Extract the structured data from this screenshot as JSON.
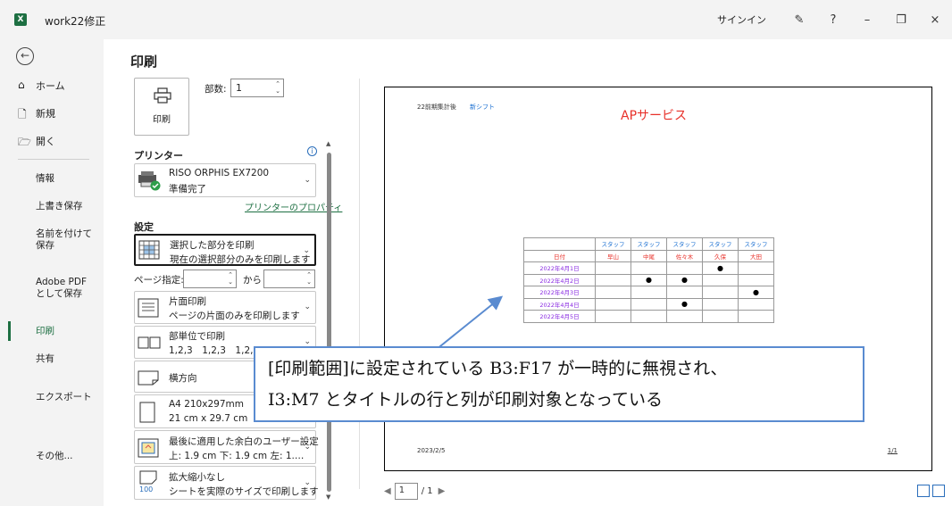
{
  "window": {
    "app_icon": "excel-icon",
    "title": "work22修正",
    "signin": "サインイン",
    "controls": [
      "pen-icon",
      "?",
      "–",
      "restore-icon",
      "×"
    ]
  },
  "nav": {
    "back": "⊖",
    "home": "ホーム",
    "new": "新規",
    "open": "開く",
    "info": "情報",
    "save": "上書き保存",
    "saveas": "名前を付けて保存",
    "pdf": "Adobe PDF として保存",
    "print": "印刷",
    "share": "共有",
    "export": "エクスポート",
    "other": "その他..."
  },
  "print": {
    "title": "印刷",
    "button": "印刷",
    "copies_label": "部数:",
    "copies_value": "1",
    "printer_section": "プリンター",
    "printer_name": "RISO ORPHIS EX7200",
    "printer_status": "準備完了",
    "printer_props": "プリンターのプロパティ",
    "settings_section": "設定",
    "range_line1": "選択した部分を印刷",
    "range_line2": "現在の選択部分のみを印刷します",
    "pages_label": "ページ指定:",
    "pages_to": "から",
    "sides_line1": "片面印刷",
    "sides_line2": "ページの片面のみを印刷します",
    "collate_line1": "部単位で印刷",
    "collate_line2": "1,2,3　1,2,3　1,2,3",
    "orientation": "横方向",
    "paper_line1": "A4 210x297mm",
    "paper_line2": "21 cm x 29.7 cm",
    "margin_line1": "最後に適用した余白のユーザー設定",
    "margin_line2": "上: 1.9 cm 下: 1.9 cm 左: 1.…",
    "scale_line1": "拡大縮小なし",
    "scale_line2": "シートを実際のサイズで印刷します",
    "scale_icon_text": "100"
  },
  "preview": {
    "header_left": "22前期集計後",
    "header_link": "新シフト",
    "title": "APサービス",
    "footer_left": "2023/2/5",
    "footer_right": "1/1",
    "table": {
      "staff_label": "スタッフ",
      "date_header": "日付",
      "names": [
        "早山",
        "中尾",
        "佐々木",
        "久保",
        "大田"
      ],
      "rows": [
        {
          "date": "2022年4月1日",
          "marks": [
            "",
            "",
            "",
            "●",
            ""
          ]
        },
        {
          "date": "2022年4月2日",
          "marks": [
            "",
            "●",
            "●",
            "",
            ""
          ]
        },
        {
          "date": "2022年4月3日",
          "marks": [
            "",
            "",
            "",
            "",
            "●"
          ]
        },
        {
          "date": "2022年4月4日",
          "marks": [
            "",
            "",
            "●",
            "",
            ""
          ]
        },
        {
          "date": "2022年4月5日",
          "marks": [
            "",
            "",
            "",
            "",
            ""
          ]
        }
      ]
    },
    "callout_line1": "[印刷範囲]に設定されている B3:F17 が一時的に無視され、",
    "callout_line2": "I3:M7 とタイトルの行と列が印刷対象となっている",
    "page_current": "1",
    "page_total": "/ 1"
  },
  "colors": {
    "excel_green": "#1d6f42",
    "title_red": "#e8312a",
    "staff_blue": "#1a6fd1",
    "date_purple": "#8a2be2",
    "callout_border": "#5a8bd0"
  }
}
